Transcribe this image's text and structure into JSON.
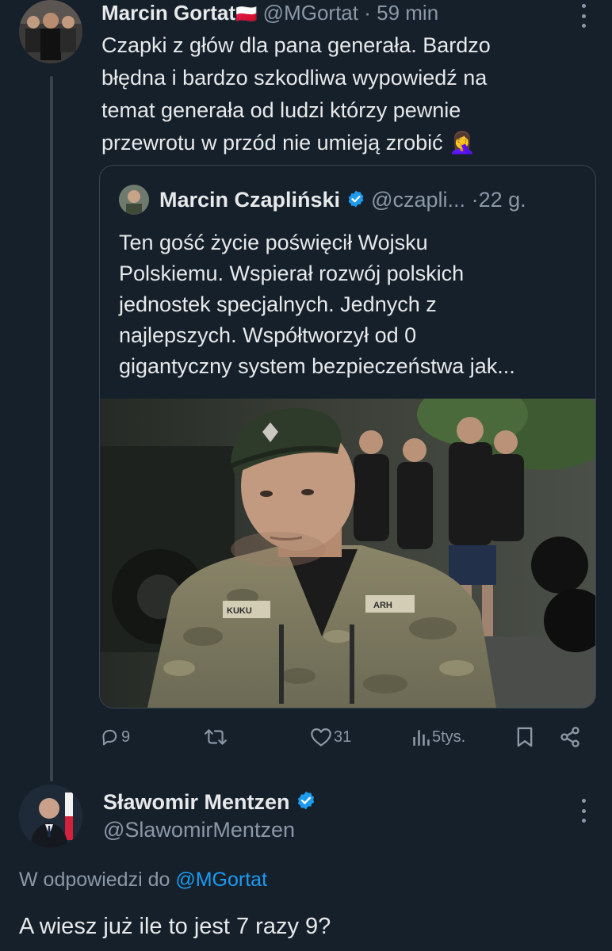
{
  "tweet": {
    "author_name": "Marcin Gortat",
    "flag": "🇵🇱",
    "handle": "@MGortat",
    "separator": "·",
    "time": "59 min",
    "lines": [
      "Czapki z głów dla pana generała. Bardzo",
      "błędna i bardzo szkodliwa wypowiedź na",
      "temat generała od ludzi którzy pewnie",
      "przewrotu w przód nie umieją zrobić 🤦‍♀️"
    ]
  },
  "quote": {
    "author_name": "Marcin Czapliński",
    "handle": "@czapli...",
    "separator": "·",
    "time": "22 g.",
    "lines": [
      "Ten gość życie poświęcił Wojsku",
      "Polskiemu. Wspierał rozwój polskich",
      "jednostek specjalnych. Jednych z",
      "najlepszych. Współtworzył od 0",
      "gigantyczny system bezpieczeństwa jak..."
    ],
    "patch_left": "KUKU",
    "patch_right": "ARH"
  },
  "actions": {
    "replies": "9",
    "retweets": "",
    "likes": "31",
    "views": "5tys."
  },
  "reply": {
    "author_name": "Sławomir Mentzen",
    "handle": "@SlawomirMentzen",
    "in_reply_prefix": "W odpowiedzi do",
    "in_reply_handle": "@MGortat",
    "text": "A wiesz już ile to jest 7 razy 9?"
  },
  "colors": {
    "background": "#15202b",
    "text": "#e7e9ea",
    "muted": "#8b98a5",
    "accent": "#1d9bf0",
    "border": "#38444d"
  },
  "icons": [
    "reply-icon",
    "retweet-icon",
    "like-icon",
    "views-icon",
    "bookmark-icon",
    "share-icon",
    "verified-icon",
    "more-icon"
  ]
}
